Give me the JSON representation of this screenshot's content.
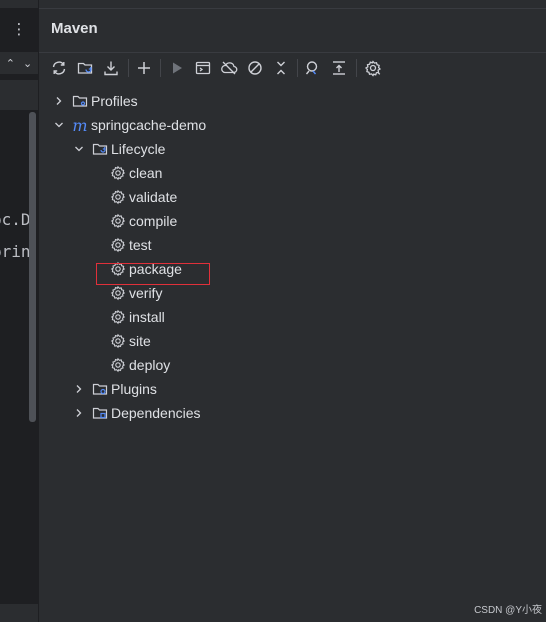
{
  "editor": {
    "menu_icon": "more-vertical-icon",
    "line1": "pc.D",
    "line2": "prin"
  },
  "maven": {
    "title": "Maven",
    "toolbar": [
      "reload-icon",
      "generate-sources-icon",
      "download-icon",
      "add-icon",
      "run-icon",
      "execute-goal-icon",
      "offline-icon",
      "skip-tests-icon",
      "collapse-icon",
      "show-dependencies-icon",
      "collapse-all-icon",
      "settings-icon"
    ],
    "tree": {
      "profiles": "Profiles",
      "project": "springcache-demo",
      "lifecycle": "Lifecycle",
      "phases": [
        "clean",
        "validate",
        "compile",
        "test",
        "package",
        "verify",
        "install",
        "site",
        "deploy"
      ],
      "plugins": "Plugins",
      "dependencies": "Dependencies"
    },
    "highlighted_phase": "package",
    "accent_color": "#548af7",
    "highlight_color": "#e0303a"
  },
  "watermark": "CSDN @Y小夜"
}
